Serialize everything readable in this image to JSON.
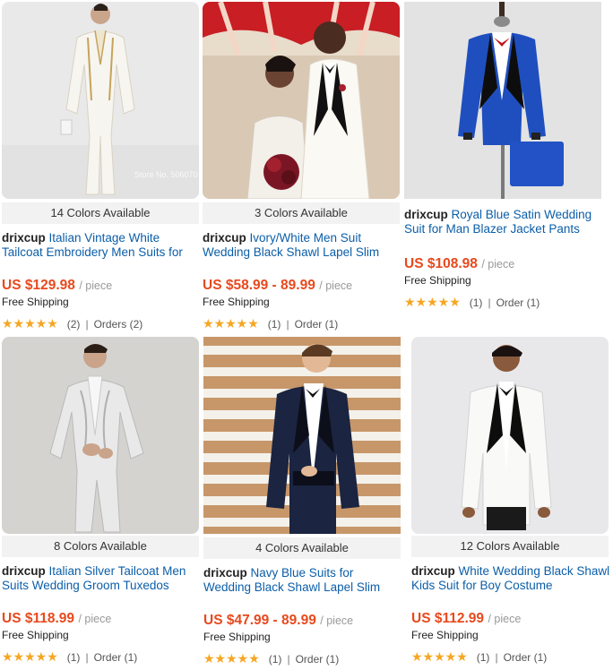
{
  "unit_label": "/ piece",
  "shipping_label": "Free Shipping",
  "colors": {
    "price": "#e8491d",
    "link": "#0b5ea8",
    "star": "#f5a623"
  },
  "products": [
    {
      "colors_available": "14 Colors Available",
      "brand": "drixcup",
      "title": "Italian Vintage White Tailcoat Embroidery Men Suits for",
      "price": "US $129.98",
      "stars": "★★★★★",
      "reviews": "(2)",
      "orders": "Orders (2)",
      "watermark": "Store No. 506070"
    },
    {
      "colors_available": "3 Colors Available",
      "brand": "drixcup",
      "title": "Ivory/White Men Suit Wedding Black Shawl Lapel Slim",
      "price": "US $58.99 - 89.99",
      "stars": "★★★★★",
      "reviews": "(1)",
      "orders": "Order (1)"
    },
    {
      "colors_available": "",
      "brand": "drixcup",
      "title": "Royal Blue Satin Wedding Suit for Man Blazer Jacket Pants",
      "price": "US $108.98",
      "stars": "★★★★★",
      "reviews": "(1)",
      "orders": "Order (1)"
    },
    {
      "colors_available": "8 Colors Available",
      "brand": "drixcup",
      "title": "Italian Silver Tailcoat Men Suits Wedding Groom Tuxedos",
      "price": "US $118.99",
      "stars": "★★★★★",
      "reviews": "(1)",
      "orders": "Order (1)"
    },
    {
      "colors_available": "4 Colors Available",
      "brand": "drixcup",
      "title": "Navy Blue Suits for Wedding Black Shawl Lapel Slim",
      "price": "US $47.99 - 89.99",
      "stars": "★★★★★",
      "reviews": "(1)",
      "orders": "Order (1)"
    },
    {
      "colors_available": "12 Colors Available",
      "brand": "drixcup",
      "title": "White Wedding Black Shawl Kids Suit for Boy Costume",
      "price": "US $112.99",
      "stars": "★★★★★",
      "reviews": "(1)",
      "orders": "Order (1)"
    }
  ]
}
